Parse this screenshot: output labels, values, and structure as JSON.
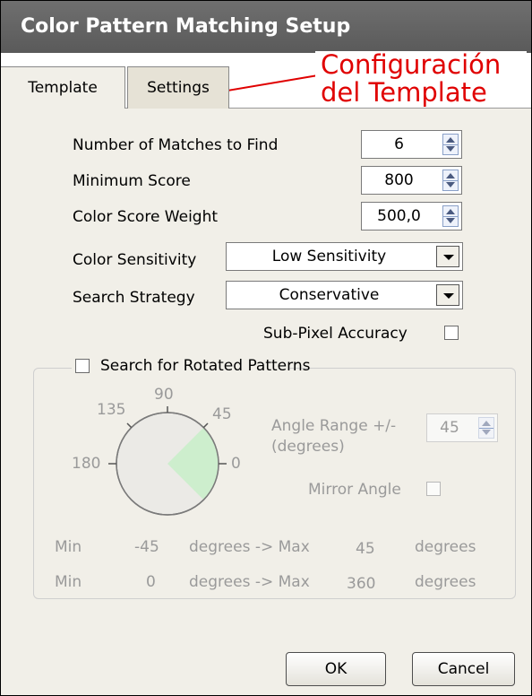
{
  "window": {
    "title": "Color Pattern Matching Setup"
  },
  "tabs": [
    {
      "label": "Template"
    },
    {
      "label": "Settings"
    }
  ],
  "annotation": {
    "line1": "Configuración",
    "line2": "del Template",
    "color": "#e00000"
  },
  "settings": {
    "matches": {
      "label": "Number of Matches to Find",
      "value": "6"
    },
    "min_score": {
      "label": "Minimum Score",
      "value": "800"
    },
    "color_weight": {
      "label": "Color Score Weight",
      "value": "500,0"
    },
    "sensitivity": {
      "label": "Color Sensitivity",
      "value": "Low Sensitivity"
    },
    "strategy": {
      "label": "Search Strategy",
      "value": "Conservative"
    },
    "subpixel": {
      "label": "Sub-Pixel Accuracy",
      "checked": false
    }
  },
  "rotation": {
    "title": "Search for Rotated Patterns",
    "checked": false,
    "dial": {
      "label_90": "90",
      "label_135": "135",
      "label_45": "45",
      "label_180": "180",
      "label_0": "0",
      "range_deg": 45
    },
    "angle_range_label_1": "Angle Range +/-",
    "angle_range_label_2": "(degrees)",
    "angle_range_value": "45",
    "mirror_label": "Mirror Angle",
    "mirror_checked": false,
    "row1": {
      "min": "Min",
      "min_val": "-45",
      "mid": "degrees -> Max",
      "max_val": "45",
      "unit": "degrees"
    },
    "row2": {
      "min": "Min",
      "min_val": "0",
      "mid": "degrees -> Max",
      "max_val": "360",
      "unit": "degrees"
    }
  },
  "buttons": {
    "ok": "OK",
    "cancel": "Cancel"
  }
}
